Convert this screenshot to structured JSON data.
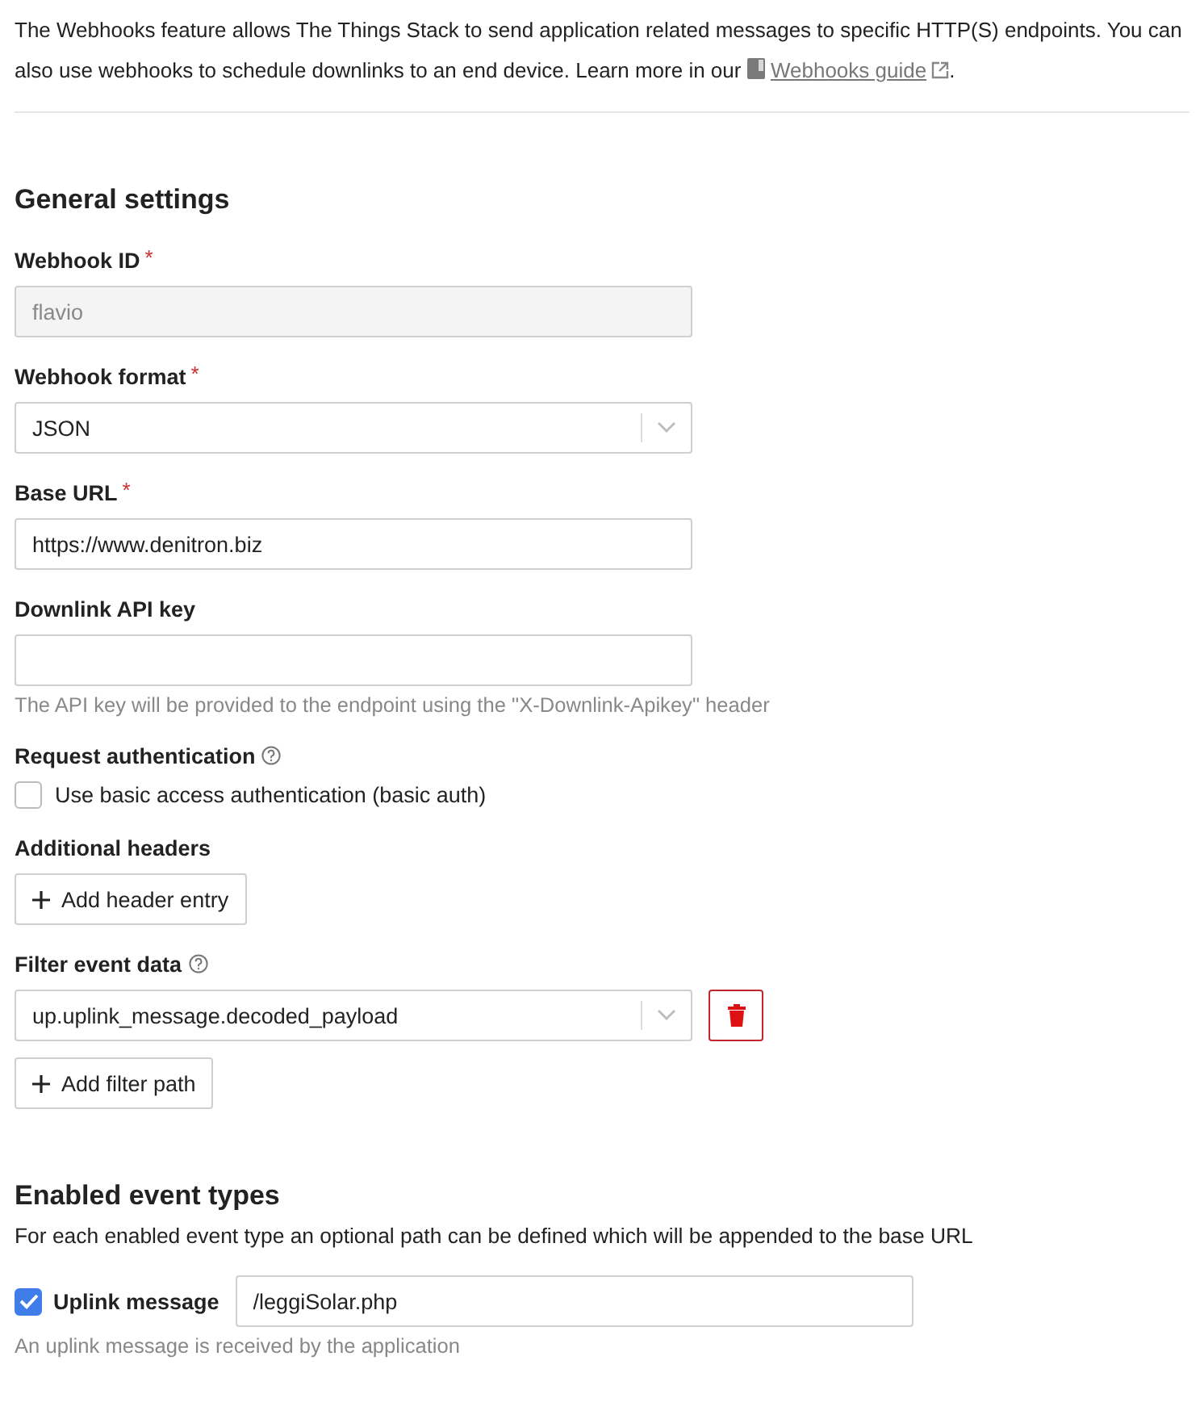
{
  "intro": {
    "text": "The Webhooks feature allows The Things Stack to send application related messages to specific HTTP(S) endpoints. You can also use webhooks to schedule downlinks to an end device. Learn more in our",
    "link": "Webhooks guide",
    "after": "."
  },
  "general": {
    "title": "General settings",
    "fields": [
      {
        "kind": "input",
        "label": "Webhook ID",
        "required_mark": "*",
        "value": "flavio",
        "disabled": true
      },
      {
        "kind": "select",
        "label": "Webhook format",
        "required_mark": "*",
        "value": "JSON"
      },
      {
        "kind": "input",
        "label": "Base URL",
        "required_mark": "*",
        "value": "https://www.denitron.biz"
      },
      {
        "kind": "input",
        "label": "Downlink API key",
        "description": "The API key will be provided to the endpoint using the \"X-Downlink-Apikey\" header"
      },
      {
        "kind": "checkbox",
        "label": "Request authentication",
        "help": true,
        "option": "Use basic access authentication (basic auth)",
        "checked": false
      },
      {
        "kind": "button",
        "label": "Additional headers",
        "button": "Add header entry"
      },
      {
        "kind": "filter",
        "label": "Filter event data",
        "help": true,
        "value": "up.uplink_message.decoded_payload",
        "button": "Add filter path"
      }
    ]
  },
  "events": {
    "title": "Enabled event types",
    "description": "For each enabled event type an optional path can be defined which will be appended to the base URL",
    "items": [
      {
        "label": "Uplink message",
        "checked": true,
        "path": "/leggiSolar.php",
        "description": "An uplink message is received by the application"
      }
    ]
  }
}
